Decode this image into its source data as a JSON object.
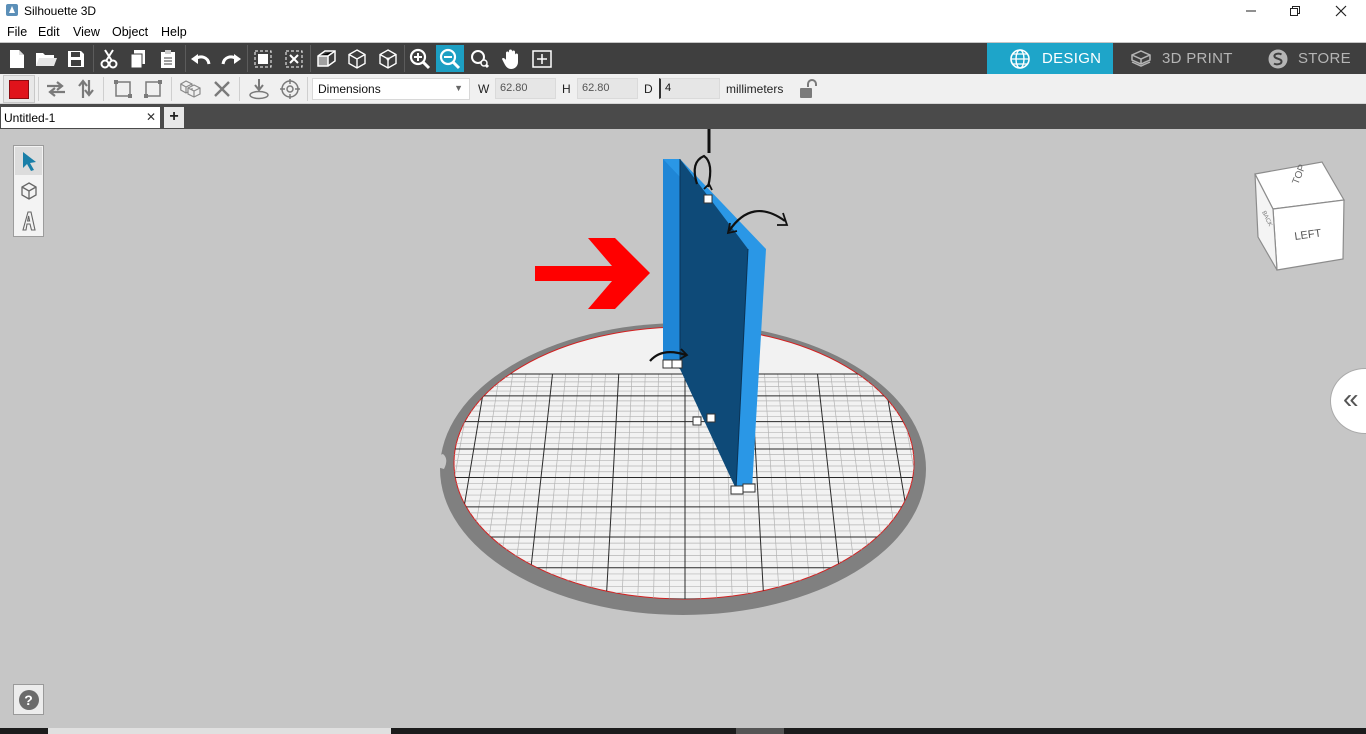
{
  "window": {
    "title": "Silhouette 3D"
  },
  "menu": [
    "File",
    "Edit",
    "View",
    "Object",
    "Help"
  ],
  "modes": [
    {
      "label": "DESIGN",
      "icon": "globe-icon",
      "active": true
    },
    {
      "label": "3D PRINT",
      "icon": "print-bed-icon",
      "active": false
    },
    {
      "label": "STORE",
      "icon": "store-s-icon",
      "active": false
    }
  ],
  "dimensions": {
    "mode": "Dimensions",
    "w_label": "W",
    "w": "62.80",
    "h_label": "H",
    "h": "62.80",
    "d_label": "D",
    "d": "4",
    "units": "millimeters"
  },
  "tab": {
    "title": "Untitled-1"
  },
  "view_cube": {
    "face_top": "TOP",
    "face_left": "LEFT",
    "face_back": "BACK"
  },
  "colors": {
    "accent": "#1ea5c9",
    "object_fill": "#0e4a78",
    "object_edge": "#2a97e6",
    "fill_swatch": "#e0131b",
    "arrow": "#ff0000"
  }
}
